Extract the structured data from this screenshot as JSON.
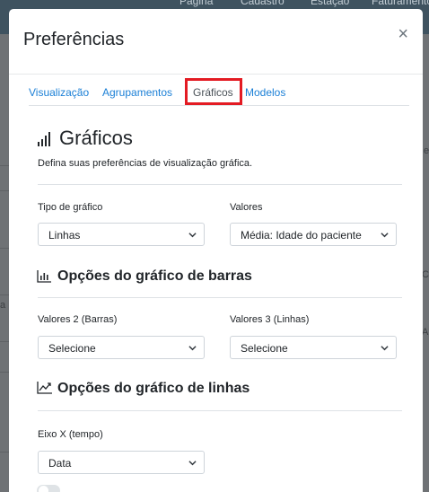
{
  "background": {
    "nav_fragments": [
      "Página",
      "Cadastro",
      "Estação",
      "Faturamento"
    ],
    "side_fragments": [
      "e",
      "Ca",
      "Al",
      "a"
    ]
  },
  "modal": {
    "title": "Preferências",
    "close_label": "×"
  },
  "tabs": [
    {
      "label": "Visualização",
      "active": false
    },
    {
      "label": "Agrupamentos",
      "active": false
    },
    {
      "label": "Gráficos",
      "active": true
    },
    {
      "label": "Modelos",
      "active": false
    }
  ],
  "graficos": {
    "icon": "bar-signal-icon",
    "title": "Gráficos",
    "description": "Defina suas preferências de visualização gráfica.",
    "tipo_label": "Tipo de gráfico",
    "tipo_value": "Linhas",
    "valores_label": "Valores",
    "valores_value": "Média: Idade do paciente"
  },
  "barras": {
    "icon": "bar-chart-icon",
    "title": "Opções do gráfico de barras",
    "valores2_label": "Valores 2 (Barras)",
    "valores2_value": "Selecione",
    "valores3_label": "Valores 3 (Linhas)",
    "valores3_value": "Selecione"
  },
  "linhas": {
    "icon": "line-chart-icon",
    "title": "Opções do gráfico de linhas",
    "eixo_label": "Eixo X (tempo)",
    "eixo_value": "Data"
  },
  "colors": {
    "accent_link": "#1a7fd6",
    "highlight": "#e31b23",
    "header_bg": "#3f5360"
  }
}
